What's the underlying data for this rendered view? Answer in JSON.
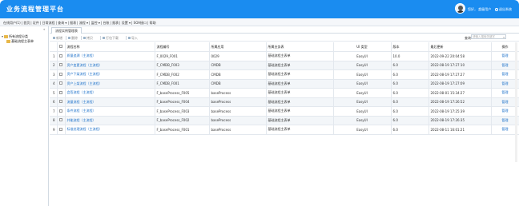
{
  "header": {
    "title": "业务流程管理平台",
    "user_text": "您好， 超级用户",
    "logout_label": "退出系统"
  },
  "menubar": {
    "items": [
      "在线用户(1)",
      "| 首页",
      "| 证件",
      "| 日常流程",
      "| 查询 ▾",
      "| 报表",
      "| 流程 ▾",
      "| 监控 ▾",
      "| 台账",
      "| 报表",
      "| 设置 ▾",
      "| SOA接口",
      "| 帮助"
    ]
  },
  "left_tree": {
    "collapse_label": "«",
    "root": "所有流程分类",
    "child": "基础流程主表单"
  },
  "tab": {
    "label": "流程实例管理表"
  },
  "toolbar": {
    "add": "新增",
    "delete": "删除",
    "copy": "拷贝",
    "export": "打包下载",
    "import": "导入"
  },
  "search": {
    "label": "查询:",
    "placeholder": "请输入搜索关键字"
  },
  "table": {
    "columns": [
      "",
      "",
      "流程名称",
      "流程编号",
      "所属应用",
      "所属业务表",
      "UI 类型",
      "版本",
      "最后更新",
      "操作"
    ],
    "rows": [
      {
        "no": "1",
        "name": "质量追溯（主流程）",
        "code": "F_0029_F001",
        "app": "0029",
        "form": "基础流程主表单",
        "ui": "EasyUI",
        "ver": "10.0",
        "updated": "2022-09-22 20:04:58",
        "op": "管理"
      },
      {
        "no": "2",
        "name": "资产变更流程（主流程）",
        "code": "F_CMDB_F003",
        "app": "CMDB",
        "form": "基础流程主表单",
        "ui": "EasyUI",
        "ver": "6.0",
        "updated": "2022-08-19 17:27:10",
        "op": "管理"
      },
      {
        "no": "3",
        "name": "资产下架流程（主流程）",
        "code": "F_CMDB_F002",
        "app": "CMDB",
        "form": "基础流程主表单",
        "ui": "EasyUI",
        "ver": "6.0",
        "updated": "2022-08-19 17:27:27",
        "op": "管理"
      },
      {
        "no": "4",
        "name": "资产上架流程（主流程）",
        "code": "F_CMDB_F001",
        "app": "CMDB",
        "form": "基础流程主表单",
        "ui": "EasyUI",
        "ver": "6.0",
        "updated": "2022-08-19 17:27:09",
        "op": "管理"
      },
      {
        "no": "5",
        "name": "会签流程（主流程）",
        "code": "F_baseProcess_F005",
        "app": "baseProcess",
        "form": "基础流程主表单",
        "ui": "EasyUI",
        "ver": "6.0",
        "updated": "2022-08-01 15:34:27",
        "op": "管理"
      },
      {
        "no": "6",
        "name": "流量流程（主流程）",
        "code": "F_baseProcess_F004",
        "app": "baseProcess",
        "form": "基础流程主表单",
        "ui": "EasyUI",
        "ver": "6.0",
        "updated": "2022-08-19 17:26:52",
        "op": "管理"
      },
      {
        "no": "7",
        "name": "条件流程（主流程）",
        "code": "F_baseProcess_F003",
        "app": "baseProcess",
        "form": "基础流程主表单",
        "ui": "EasyUI",
        "ver": "6.0",
        "updated": "2022-08-19 17:25:39",
        "op": "管理"
      },
      {
        "no": "8",
        "name": "并能流程（主流程）",
        "code": "F_baseProcess_F002",
        "app": "baseProcess",
        "form": "基础流程主表单",
        "ui": "EasyUI",
        "ver": "6.0",
        "updated": "2022-08-19 17:26:35",
        "op": "管理"
      },
      {
        "no": "9",
        "name": "标准处理流程（主流程）",
        "code": "F_baseProcess_F001",
        "app": "baseProcess",
        "form": "基础流程主表单",
        "ui": "EasyUI",
        "ver": "6.0",
        "updated": "2022-08-11 16:01:21",
        "op": "管理"
      }
    ]
  }
}
